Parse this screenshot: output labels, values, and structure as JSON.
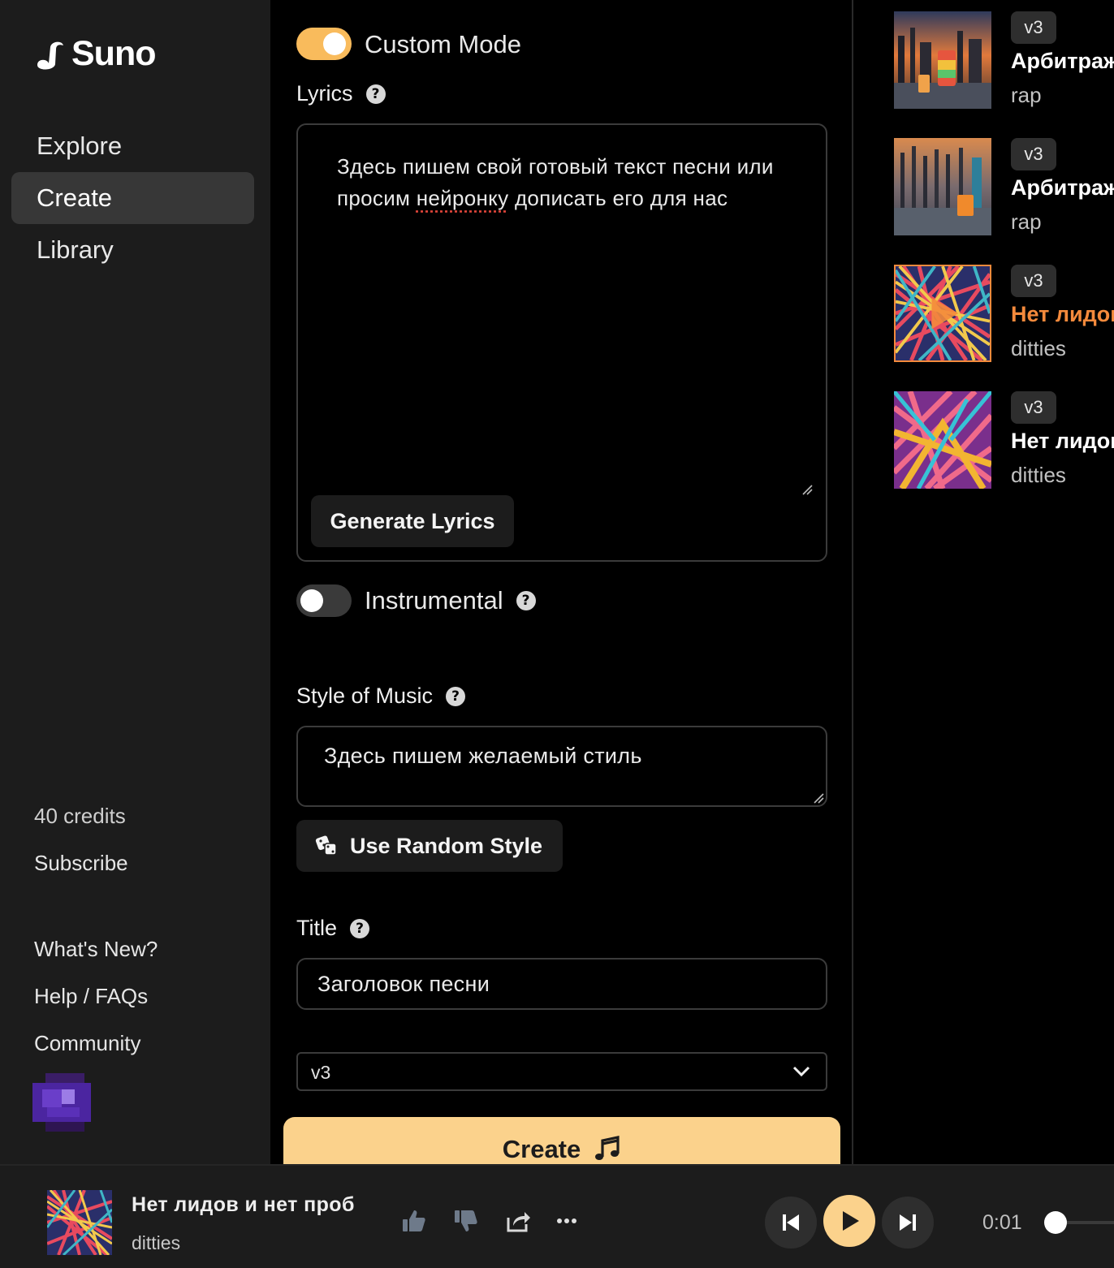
{
  "sidebar": {
    "brand": "Suno",
    "nav": [
      {
        "label": "Explore"
      },
      {
        "label": "Create",
        "active": true
      },
      {
        "label": "Library"
      }
    ],
    "credits": "40 credits",
    "subscribe": "Subscribe",
    "whats_new": "What's New?",
    "help": "Help / FAQs",
    "community": "Community"
  },
  "form": {
    "custom_mode": {
      "label": "Custom Mode",
      "on": true
    },
    "lyrics": {
      "label": "Lyrics",
      "text_before": "Здесь пишем  свой готовый текст песни или просим ",
      "text_flagged": "нейронку",
      "text_after": " дописать его для нас"
    },
    "generate_lyrics": "Generate Lyrics",
    "instrumental": {
      "label": "Instrumental",
      "on": false
    },
    "style": {
      "label": "Style of Music",
      "value": "Здесь пишем желаемый стиль"
    },
    "random_style": "Use Random Style",
    "title": {
      "label": "Title",
      "value": "Заголовок песни"
    },
    "version": {
      "selected": "v3"
    },
    "create": "Create"
  },
  "songs": [
    {
      "version": "v3",
      "title": "Арбитраж",
      "genre": "rap",
      "playing": false
    },
    {
      "version": "v3",
      "title": "Арбитраж",
      "genre": "rap",
      "playing": false
    },
    {
      "version": "v3",
      "title": "Нет лидов",
      "genre": "ditties",
      "playing": true
    },
    {
      "version": "v3",
      "title": "Нет лидов",
      "genre": "ditties",
      "playing": false
    }
  ],
  "player": {
    "title": "Нет лидов и нет проб",
    "genre": "ditties",
    "time": "0:01"
  },
  "colors": {
    "accent": "#f9bb5c",
    "create_button": "#fbd28c",
    "playing_title": "#f48a3c",
    "sidebar_bg": "#1c1c1c"
  },
  "icons": [
    "suno-logo-icon",
    "help-icon",
    "dice-icon",
    "chevron-down-icon",
    "music-note-icon",
    "thumbs-up-icon",
    "thumbs-down-icon",
    "share-icon",
    "more-icon",
    "skip-back-icon",
    "play-icon",
    "skip-forward-icon"
  ]
}
